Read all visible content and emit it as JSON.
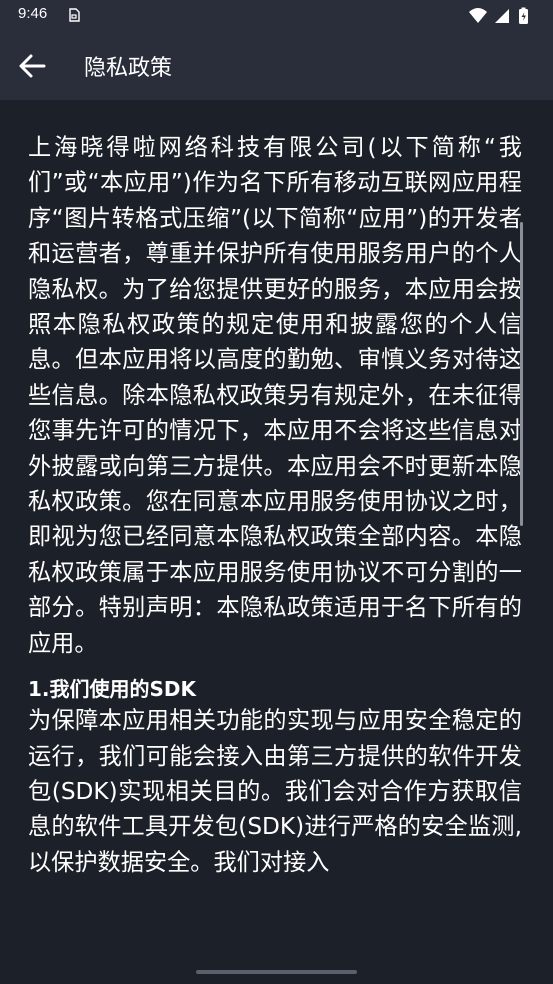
{
  "status_bar": {
    "time": "9:46"
  },
  "header": {
    "title": "隐私政策",
    "back_icon": "arrow-left-icon"
  },
  "content": {
    "intro": "上海晓得啦网络科技有限公司(以下简称“我们”或“本应用”)作为名下所有移动互联网应用程序“图片转格式压缩”(以下简称“应用”)的开发者和运营者，尊重并保护所有使用服务用户的个人隐私权。为了给您提供更好的服务，本应用会按照本隐私权政策的规定使用和披露您的个人信息。但本应用将以高度的勤勉、审慎义务对待这些信息。除本隐私权政策另有规定外，在未征得您事先许可的情况下，本应用不会将这些信息对外披露或向第三方提供。本应用会不时更新本隐私权政策。您在同意本应用服务使用协议之时，即视为您已经同意本隐私权政策全部内容。本隐私权政策属于本应用服务使用协议不可分割的一部分。特别声明：本隐私政策适用于名下所有的应用。",
    "section1_heading": "1.我们使用的SDK",
    "section1_body": "为保障本应用相关功能的实现与应用安全稳定的运行，我们可能会接入由第三方提供的软件开发包(SDK)实现相关目的。我们会对合作方获取信息的软件工具开发包(SDK)进行严格的安全监测,以保护数据安全。我们对接入"
  }
}
